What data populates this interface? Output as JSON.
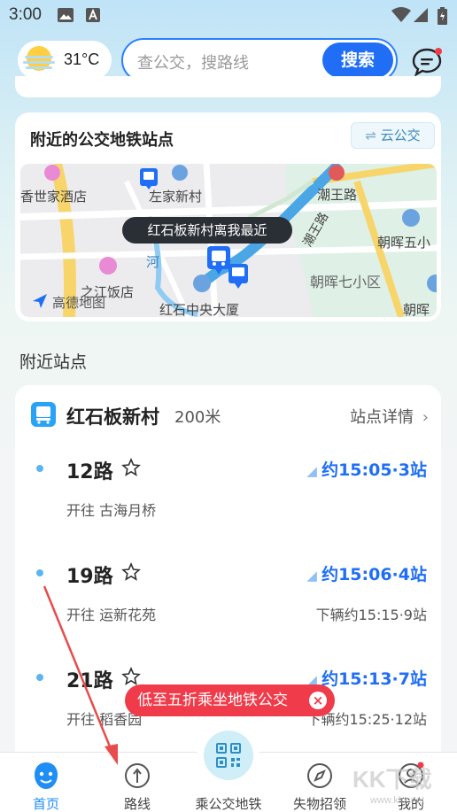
{
  "status_bar": {
    "time": "3:00"
  },
  "weather": {
    "temperature": "31°C"
  },
  "search": {
    "placeholder": "查公交，搜路线",
    "button_label": "搜索"
  },
  "nearby": {
    "title": "附近的公交地铁站点",
    "cloud_button": "云公交",
    "map": {
      "tooltip": "红石板新村离我最近",
      "labels": [
        "香世家酒店",
        "左家新村",
        "潮王路",
        "潮王路",
        "朝晖五小",
        "朝晖七小区",
        "之江饭店",
        "红石中央大厦",
        "朝晖",
        "河",
        "高德地图"
      ]
    }
  },
  "section_title": "附近站点",
  "stop": {
    "name": "红石板新村",
    "distance": "200米",
    "detail_label": "站点详情",
    "routes": [
      {
        "number": "12路",
        "eta": "约15:05·3站",
        "direction": "开往 古海月桥",
        "next": ""
      },
      {
        "number": "19路",
        "eta": "约15:06·4站",
        "direction": "开往 运新花苑",
        "next": "下辆约15:15·9站"
      },
      {
        "number": "21路",
        "eta": "约15:13·7站",
        "direction": "开往 稻香园",
        "next": "下辆约15:25·12站"
      }
    ]
  },
  "promo": {
    "text": "低至五折乘坐地铁公交"
  },
  "tabbar": {
    "items": [
      {
        "label": "首页",
        "icon": "home-face-icon",
        "active": true
      },
      {
        "label": "路线",
        "icon": "route-icon",
        "active": false
      },
      {
        "label": "乘公交地铁",
        "icon": "qr-code-icon",
        "active": false
      },
      {
        "label": "失物招领",
        "icon": "compass-icon",
        "active": false
      },
      {
        "label": "我的",
        "icon": "profile-icon",
        "active": false
      }
    ]
  },
  "watermark": {
    "text": "KK下载",
    "sub": "www.kkx.net"
  },
  "colors": {
    "accent": "#1f6ef5",
    "promo": "#ef3b4a",
    "eta": "#1f6ef5"
  }
}
